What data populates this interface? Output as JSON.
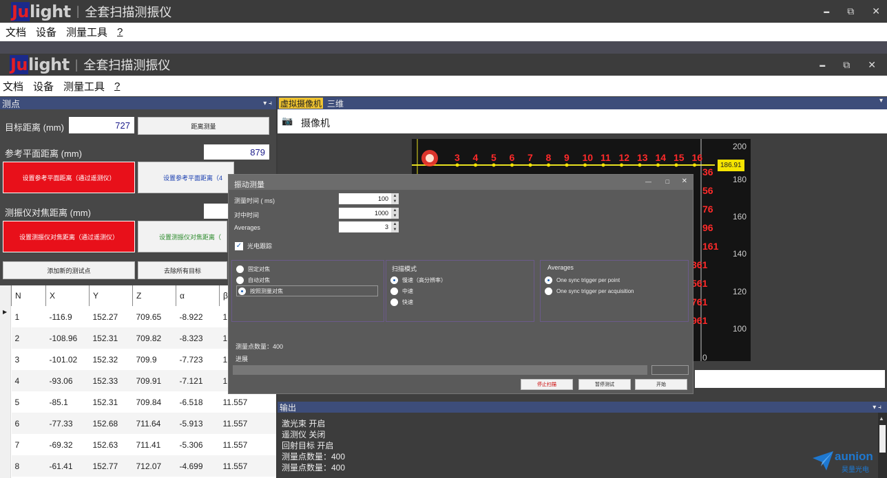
{
  "app": {
    "logo_ju": "Ju",
    "logo_light": "light",
    "title": "全套扫描测振仪",
    "win_min": "▬",
    "win_restore": "⧉",
    "win_close": "✕"
  },
  "menu": [
    "文档",
    "设备",
    "测量工具",
    "?"
  ],
  "left_panel": {
    "header": "测点",
    "header_ctrl": "▾ ⫞",
    "target_distance_label": "目标距离 (mm)",
    "target_distance_value": "727",
    "distance_button": "距离测量",
    "ref_plane_label": "参考平面距离 (mm)",
    "ref_plane_value": "879",
    "set_ref_red": "设置参考平面距离（通过遥测仪）",
    "set_ref_white": "设置参考平面距离（4",
    "focus_label": "测振仪对焦距离 (mm)",
    "set_focus_red": "设置测振仪对焦距离（通过遥测仪）",
    "set_focus_white": "设置测振仪对焦距离（",
    "add_point": "添加新的测试点",
    "remove_all": "去除所有目标"
  },
  "table": {
    "columns": [
      "N",
      "X",
      "Y",
      "Z",
      "α",
      "β"
    ],
    "rows": [
      [
        "1",
        "-116.9",
        "152.27",
        "709.65",
        "-8.922",
        "1"
      ],
      [
        "2",
        "-108.96",
        "152.31",
        "709.82",
        "-8.323",
        "1"
      ],
      [
        "3",
        "-101.02",
        "152.32",
        "709.9",
        "-7.723",
        "1"
      ],
      [
        "4",
        "-93.06",
        "152.33",
        "709.91",
        "-7.121",
        "1"
      ],
      [
        "5",
        "-85.1",
        "152.31",
        "709.84",
        "-6.518",
        "11.557"
      ],
      [
        "6",
        "-77.33",
        "152.68",
        "711.64",
        "-5.913",
        "11.557"
      ],
      [
        "7",
        "-69.32",
        "152.63",
        "711.41",
        "-5.306",
        "11.557"
      ],
      [
        "8",
        "-61.41",
        "152.77",
        "712.07",
        "-4.699",
        "11.557"
      ]
    ]
  },
  "right_panel": {
    "tab_camera": "虚拟摄像机",
    "tab_3d": "三维",
    "camera_label": "摄像机",
    "marker_value": "186.91",
    "y_ticks": [
      "200",
      "180",
      "160",
      "140",
      "120",
      "100",
      "0"
    ],
    "grid_top_numbers": [
      "3",
      "4",
      "5",
      "6",
      "7",
      "8",
      "9",
      "10",
      "11",
      "12",
      "13",
      "14",
      "15",
      "16"
    ],
    "grid_partial": [
      "36",
      "56",
      "76",
      "96",
      "161",
      "361",
      "561",
      "761",
      "961"
    ]
  },
  "dialog": {
    "title": "振动测量",
    "ctrl_min": "—",
    "ctrl_max": "□",
    "ctrl_close": "✕",
    "measure_time_label": "测量时间 ( ms)",
    "measure_time_value": "100",
    "sample_label": "对中时间",
    "sample_value": "1000",
    "averages_label": "Averages",
    "averages_value": "3",
    "checkbox_label": "光电跟踪",
    "group1": {
      "title": "",
      "options": [
        "固定对焦",
        "自动对焦",
        "按照测量对焦"
      ]
    },
    "group2": {
      "title": "扫描模式",
      "options": [
        "慢速（高分辨率）",
        "中速",
        "快速"
      ]
    },
    "group3": {
      "title": "Averages",
      "options": [
        "One sync trigger per point",
        "One sync trigger per acquisition"
      ]
    },
    "points_count": "测量点数量：400",
    "progress_label": "进展",
    "btn_stop": "停止扫描",
    "btn_pause": "暂停测试",
    "btn_start": "开始"
  },
  "output": {
    "header": "输出",
    "lines": [
      "激光束 开启",
      "遥测仪 关闭",
      "回射目标 开启",
      "测量点数量：400",
      "测量点数量：400"
    ]
  },
  "watermark": {
    "brand": "aunion",
    "sub": "昊量光电"
  }
}
